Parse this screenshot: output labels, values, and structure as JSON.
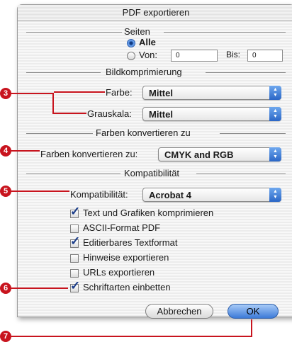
{
  "dialog": {
    "title": "PDF exportieren",
    "sections": {
      "seiten": "Seiten",
      "bildkomprimierung": "Bildkomprimierung",
      "farben": "Farben konvertieren zu",
      "kompatibilitaet": "Kompatibilität"
    },
    "pages": {
      "all_label": "Alle",
      "all_selected": true,
      "from_label": "Von:",
      "from_value": "0",
      "to_label": "Bis:",
      "to_value": "0"
    },
    "compression": {
      "color_label": "Farbe:",
      "color_value": "Mittel",
      "gray_label": "Grauskala:",
      "gray_value": "Mittel"
    },
    "colors": {
      "label": "Farben konvertieren zu:",
      "value": "CMYK and RGB"
    },
    "compat": {
      "label": "Kompatibilität:",
      "value": "Acrobat 4"
    },
    "options": [
      {
        "label": "Text und Grafiken komprimieren",
        "checked": true
      },
      {
        "label": "ASCII-Format PDF",
        "checked": false
      },
      {
        "label": "Editierbares Textformat",
        "checked": true
      },
      {
        "label": "Hinweise exportieren",
        "checked": false
      },
      {
        "label": "URLs exportieren",
        "checked": false
      },
      {
        "label": "Schriftarten einbetten",
        "checked": true
      }
    ],
    "buttons": {
      "cancel": "Abbrechen",
      "ok": "OK"
    }
  },
  "callouts": {
    "c3": "3",
    "c4": "4",
    "c5": "5",
    "c6": "6",
    "c7": "7"
  },
  "colors": {
    "callout_red": "#c8141e",
    "accent_blue": "#3c7ad8"
  }
}
